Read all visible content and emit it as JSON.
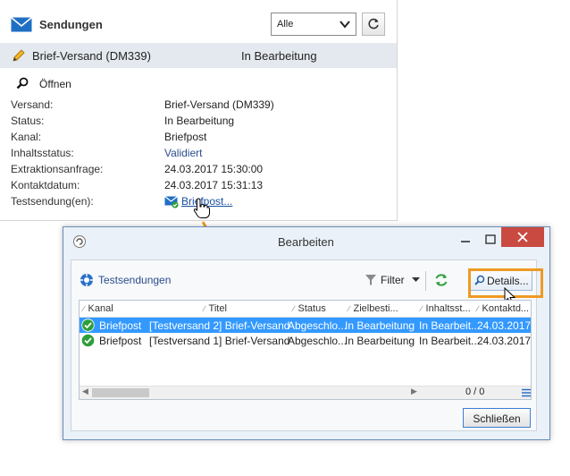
{
  "panel": {
    "title": "Sendungen",
    "filter_value": "Alle",
    "selected": {
      "name": "Brief-Versand (DM339)",
      "status": "In Bearbeitung"
    },
    "open_label": "Öffnen",
    "properties": [
      {
        "label": "Versand:",
        "value": "Brief-Versand (DM339)"
      },
      {
        "label": "Status:",
        "value": "In Bearbeitung"
      },
      {
        "label": "Kanal:",
        "value": "Briefpost"
      },
      {
        "label": "Inhaltsstatus:",
        "value": "Validiert"
      },
      {
        "label": "Extraktionsanfrage:",
        "value": "24.03.2017 15:30:00"
      },
      {
        "label": "Kontaktdatum:",
        "value": "24.03.2017 15:31:13"
      },
      {
        "label": "Testsendung(en):",
        "value": "Briefpost..."
      }
    ]
  },
  "dialog": {
    "title": "Bearbeiten",
    "toolbar": {
      "tab_label": "Testsendungen",
      "filter_label": "Filter",
      "details_label": "Details..."
    },
    "columns": [
      "Kanal",
      "Titel",
      "Status",
      "Zielbesti...",
      "Inhaltsst...",
      "Kontaktd..."
    ],
    "rows": [
      {
        "kanal": "Briefpost",
        "titel": "[Testversand 2] Brief-Versand",
        "status": "Abgeschlo...",
        "ziel": "In Bearbeitung",
        "inhalt": "In Bearbeit...",
        "kontakt": "24.03.2017",
        "selected": true
      },
      {
        "kanal": "Briefpost",
        "titel": "[Testversand 1] Brief-Versand",
        "status": "Abgeschlo...",
        "ziel": "In Bearbeitung",
        "inhalt": "In Bearbeit...",
        "kontakt": "24.03.2017",
        "selected": false
      }
    ],
    "count": "0 / 0",
    "close_label": "Schließen"
  },
  "colors": {
    "accent": "#ee9a23",
    "selection": "#3399ff",
    "close_red": "#c94a41",
    "ok_green": "#2e9e3a",
    "link_blue": "#1a4fa0"
  }
}
